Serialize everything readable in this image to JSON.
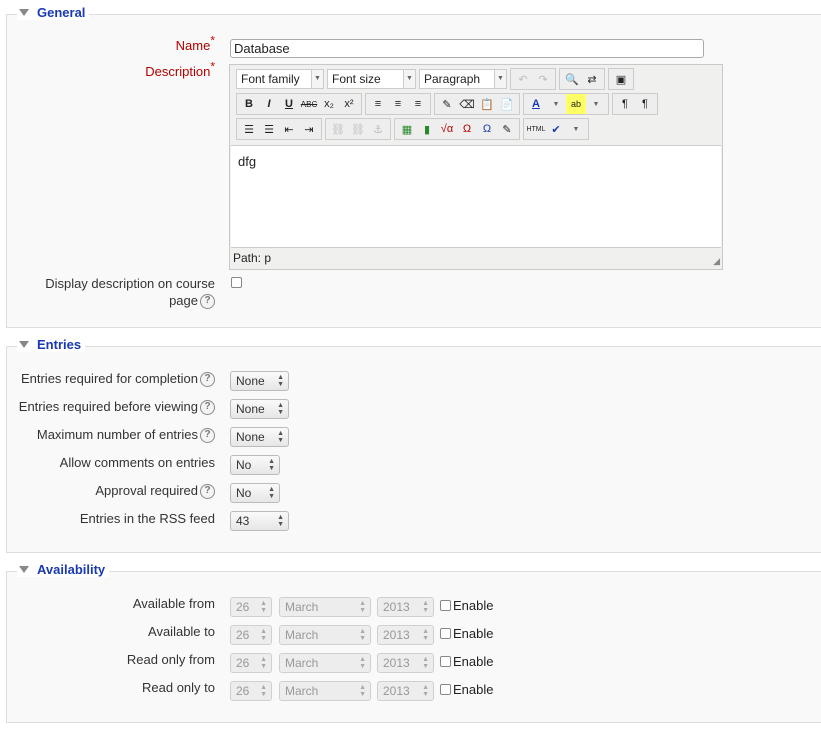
{
  "general": {
    "legend": "General",
    "name_label": "Name",
    "name_value": "Database",
    "description_label": "Description",
    "editor": {
      "font_family": "Font family",
      "font_size": "Font size",
      "format": "Paragraph",
      "content": "dfg",
      "path": "Path: p"
    },
    "display_desc_label_1": "Display description on course",
    "display_desc_label_2": "page"
  },
  "entries": {
    "legend": "Entries",
    "fields": [
      {
        "label": "Entries required for completion",
        "value": "None",
        "help": true
      },
      {
        "label": "Entries required before viewing",
        "value": "None",
        "help": true
      },
      {
        "label": "Maximum number of entries",
        "value": "None",
        "help": true
      },
      {
        "label": "Allow comments on entries",
        "value": "No",
        "help": false
      },
      {
        "label": "Approval required",
        "value": "No",
        "help": true
      },
      {
        "label": "Entries in the RSS feed",
        "value": "43",
        "help": false
      }
    ]
  },
  "availability": {
    "legend": "Availability",
    "rows": [
      {
        "label": "Available from",
        "day": "26",
        "month": "March",
        "year": "2013",
        "enable": "Enable"
      },
      {
        "label": "Available to",
        "day": "26",
        "month": "March",
        "year": "2013",
        "enable": "Enable"
      },
      {
        "label": "Read only from",
        "day": "26",
        "month": "March",
        "year": "2013",
        "enable": "Enable"
      },
      {
        "label": "Read only to",
        "day": "26",
        "month": "March",
        "year": "2013",
        "enable": "Enable"
      }
    ]
  },
  "colors": {
    "legend": "#1a3ab0",
    "required": "#cc0000",
    "label_red": "#b30000"
  }
}
